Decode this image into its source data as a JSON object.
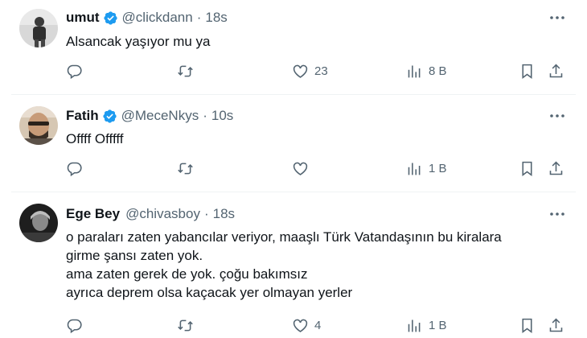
{
  "tweets": [
    {
      "name": "umut",
      "handle": "@clickdann",
      "dot": "·",
      "time": "18s",
      "text": [
        "Alsancak yaşıyor mu ya"
      ],
      "likes": "23",
      "views": "8 B",
      "avatar_colors": [
        "#cfcfcf",
        "#3a3a3a"
      ]
    },
    {
      "name": "Fatih",
      "handle": "@MeceNkys",
      "dot": "·",
      "time": "10s",
      "text": [
        "Offff Offfff"
      ],
      "likes": "",
      "views": "1 B",
      "avatar_colors": [
        "#c9b49a",
        "#2b241d"
      ]
    },
    {
      "name": "Ege Bey",
      "handle": "@chivasboy",
      "dot": "·",
      "time": "18s",
      "text": [
        "o paraları zaten yabancılar veriyor, maaşlı Türk Vatandaşının bu kiralara",
        "girme şansı zaten yok.",
        "ama zaten gerek de yok. çoğu bakımsız",
        "ayrıca deprem olsa kaçacak yer olmayan yerler"
      ],
      "likes": "4",
      "views": "1 B",
      "avatar_colors": [
        "#2a2a2a",
        "#bdbdbd"
      ]
    }
  ],
  "colors": {
    "text": "#0f1419",
    "secondary": "#536471",
    "verified": "#1d9bf0",
    "divider": "#eff3f4"
  },
  "icons": [
    "reply-icon",
    "retweet-icon",
    "like-icon",
    "views-icon",
    "bookmark-icon",
    "share-icon",
    "more-icon",
    "verified-badge-icon"
  ]
}
